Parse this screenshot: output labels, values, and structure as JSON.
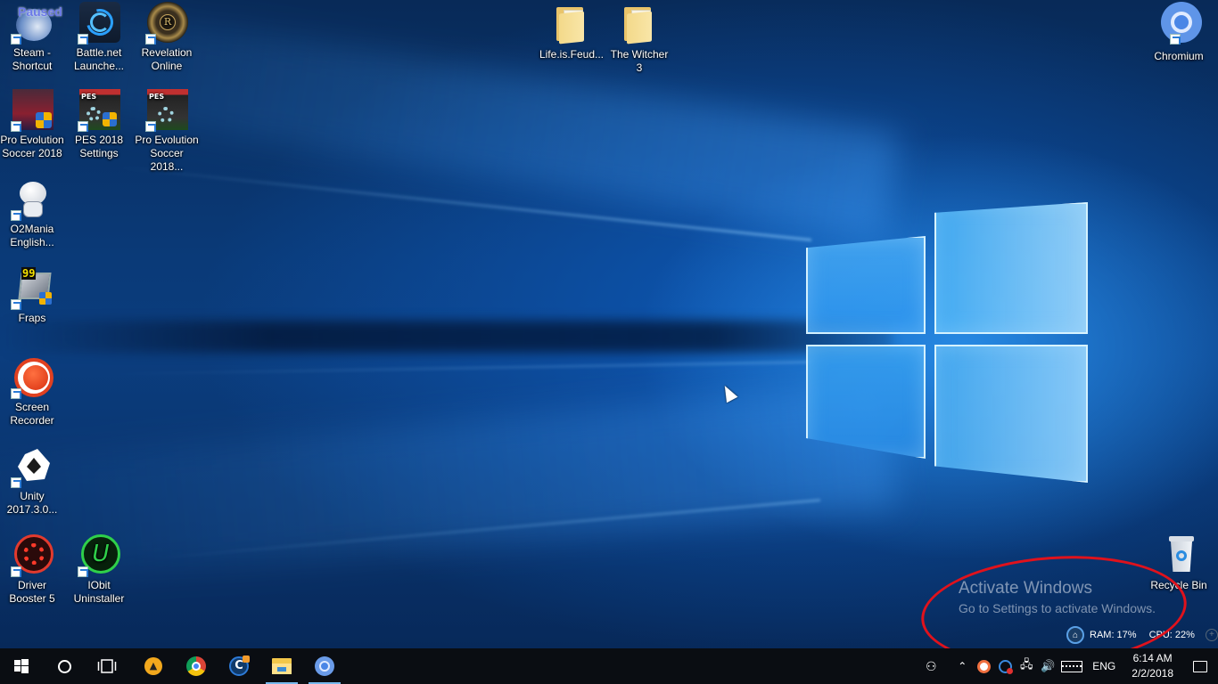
{
  "desktop": {
    "icons_left": [
      {
        "id": "steam",
        "label": "Steam - Shortcut",
        "line1": "Steam -",
        "line2": "Shortcut",
        "badge": "Paused",
        "icon": "steam-icon"
      },
      {
        "id": "battlenet",
        "label": "Battle.net Launche...",
        "line1": "Battle.net",
        "line2": "Launche...",
        "icon": "battlenet-icon"
      },
      {
        "id": "revelation",
        "label": "Revelation Online",
        "line1": "Revelation",
        "line2": "Online",
        "icon": "revelation-icon"
      },
      {
        "id": "pes2018",
        "label": "Pro Evolution Soccer 2018",
        "line1": "Pro Evolution",
        "line2": "Soccer 2018",
        "icon": "pes-icon"
      },
      {
        "id": "pes2018-settings",
        "label": "PES 2018 Settings",
        "line1": "PES 2018",
        "line2": "Settings",
        "icon": "pes-settings-icon"
      },
      {
        "id": "pes2018-2",
        "label": "Pro Evolution Soccer 2018...",
        "line1": "Pro Evolution",
        "line2": "Soccer 2018...",
        "icon": "pes-settings-icon"
      },
      {
        "id": "o2mania",
        "label": "O2Mania English...",
        "line1": "O2Mania",
        "line2": "English...",
        "icon": "o2mania-icon"
      },
      {
        "id": "fraps",
        "label": "Fraps",
        "line1": "Fraps",
        "line2": "",
        "badge": "99",
        "icon": "fraps-icon"
      },
      {
        "id": "screen-recorder",
        "label": "Screen Recorder",
        "line1": "Screen",
        "line2": "Recorder",
        "icon": "record-icon"
      },
      {
        "id": "unity",
        "label": "Unity 2017.3.0...",
        "line1": "Unity",
        "line2": "2017.3.0...",
        "icon": "unity-icon"
      },
      {
        "id": "driver-booster",
        "label": "Driver Booster 5",
        "line1": "Driver",
        "line2": "Booster 5",
        "icon": "driver-booster-icon"
      },
      {
        "id": "iobit",
        "label": "IObit Uninstaller",
        "line1": "IObit",
        "line2": "Uninstaller",
        "icon": "iobit-uninstaller-icon"
      }
    ],
    "folders": [
      {
        "label": "Life.is.Feud...",
        "line1": "Life.is.Feud...",
        "line2": ""
      },
      {
        "label": "The Witcher 3",
        "line1": "The Witcher",
        "line2": "3"
      }
    ],
    "chromium": {
      "label": "Chromium"
    },
    "recycle_bin": {
      "label": "Recycle Bin"
    }
  },
  "activation": {
    "title": "Activate Windows",
    "subtitle": "Go to Settings to activate Windows.",
    "annotation_color": "#e0121c"
  },
  "monitor_widget": {
    "ram": "RAM: 17%",
    "cpu": "CPU: 22%",
    "ram_percent": 17,
    "cpu_percent": 22
  },
  "taskbar": {
    "apps": [
      {
        "name": "start",
        "icon": "windows-start-icon"
      },
      {
        "name": "cortana",
        "icon": "cortana-search-icon"
      },
      {
        "name": "task-view",
        "icon": "task-view-icon"
      },
      {
        "name": "aimp",
        "icon": "aimp-icon"
      },
      {
        "name": "chrome",
        "icon": "chrome-icon"
      },
      {
        "name": "ccleaner",
        "icon": "ccleaner-icon"
      },
      {
        "name": "file-explorer",
        "icon": "file-explorer-icon",
        "active": true
      },
      {
        "name": "chromium",
        "icon": "chromium-icon",
        "active": true
      }
    ],
    "tray": {
      "language": "ENG",
      "time": "6:14 AM",
      "date": "2/2/2018"
    }
  },
  "colors": {
    "accent": "#76b9ed",
    "taskbar": "#0a0d12",
    "wallpaper": "#0b3d7e"
  }
}
